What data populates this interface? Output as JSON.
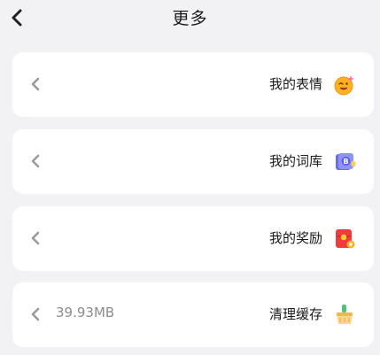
{
  "header": {
    "title": "更多"
  },
  "items": [
    {
      "label": "我的表情",
      "extra": "",
      "icon": "emoji-sticker-icon"
    },
    {
      "label": "我的词库",
      "extra": "",
      "icon": "dictionary-icon"
    },
    {
      "label": "我的奖励",
      "extra": "",
      "icon": "red-envelope-icon"
    },
    {
      "label": "清理缓存",
      "extra": "39.93MB",
      "icon": "broom-clean-icon"
    }
  ],
  "colors": {
    "background": "#f2f2f4",
    "card": "#ffffff",
    "chevron": "#9a9a9a",
    "text": "#1a1a1a",
    "secondary_text": "#8c8c8c"
  }
}
